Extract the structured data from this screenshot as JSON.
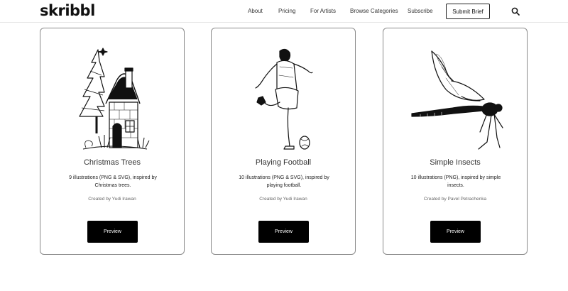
{
  "header": {
    "logo": "skribbl",
    "nav": [
      {
        "label": "About"
      },
      {
        "label": "Pricing"
      },
      {
        "label": "For Artists"
      },
      {
        "label": "Browse Categories"
      },
      {
        "label": "Subscribe"
      }
    ],
    "submit_label": "Submit Brief"
  },
  "cards": [
    {
      "title": "Christmas Trees",
      "description": "9 illustrations (PNG & SVG), inspired by Christmas trees.",
      "credit": "Created by Yudi Irawan",
      "button_label": "Preview"
    },
    {
      "title": "Playing Football",
      "description": "10 illustrations (PNG & SVG), inspired by playing football.",
      "credit": "Created by Yudi Irawan",
      "button_label": "Preview"
    },
    {
      "title": "Simple Insects",
      "description": "10 illustrations (PNG), inspired by simple insects.",
      "credit": "Created by Pavel Petrachenka",
      "button_label": "Preview"
    }
  ]
}
